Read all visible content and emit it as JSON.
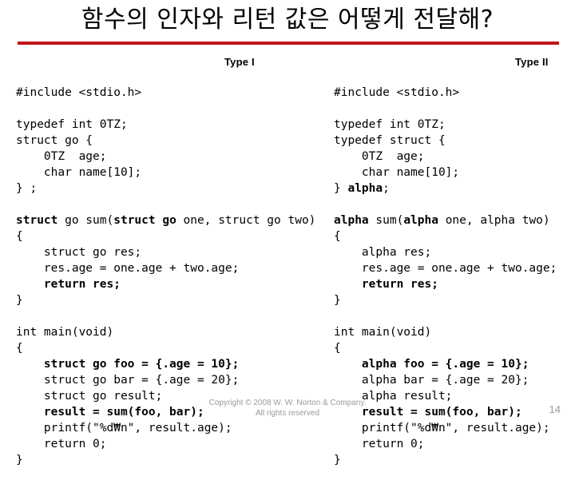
{
  "slide": {
    "title": "함수의 인자와 리턴 값은 어떻게 전달해?",
    "accent_color": "#C0151B",
    "background_color": "#FFFFFF",
    "page_number": "14"
  },
  "columns": {
    "left": {
      "type_label": "Type I",
      "lines": [
        [
          {
            "t": "#include <stdio.h>",
            "b": false
          }
        ],
        [],
        [
          {
            "t": "typedef int 0TZ;",
            "b": false
          }
        ],
        [
          {
            "t": "struct go {",
            "b": false
          }
        ],
        [
          {
            "t": "    0TZ  age;",
            "b": false
          }
        ],
        [
          {
            "t": "    char name[10];",
            "b": false
          }
        ],
        [
          {
            "t": "} ;",
            "b": false
          }
        ],
        [],
        [
          {
            "t": "struct",
            "b": true
          },
          {
            "t": " go sum(",
            "b": false
          },
          {
            "t": "struct go",
            "b": true
          },
          {
            "t": " one, struct go two)",
            "b": false
          }
        ],
        [
          {
            "t": "{",
            "b": false
          }
        ],
        [
          {
            "t": "    struct go res;",
            "b": false
          }
        ],
        [
          {
            "t": "    res.age = one.age + two.age;",
            "b": false
          }
        ],
        [
          {
            "t": "    ",
            "b": false
          },
          {
            "t": "return res;",
            "b": true
          }
        ],
        [
          {
            "t": "}",
            "b": false
          }
        ],
        [],
        [
          {
            "t": "int main(void)",
            "b": false
          }
        ],
        [
          {
            "t": "{",
            "b": false
          }
        ],
        [
          {
            "t": "    ",
            "b": false
          },
          {
            "t": "struct go foo = {.age = 10};",
            "b": true
          }
        ],
        [
          {
            "t": "    struct go bar = {.age = 20};",
            "b": false
          }
        ],
        [
          {
            "t": "    struct go result;",
            "b": false
          }
        ],
        [
          {
            "t": "    ",
            "b": false
          },
          {
            "t": "result = sum(foo, bar);",
            "b": true
          }
        ],
        [
          {
            "t": "    printf(\"%d₩n\", result.age);",
            "b": false
          }
        ],
        [
          {
            "t": "    return 0;",
            "b": false
          }
        ],
        [
          {
            "t": "}",
            "b": false
          }
        ]
      ]
    },
    "right": {
      "type_label": "Type II",
      "lines": [
        [
          {
            "t": "#include <stdio.h>",
            "b": false
          }
        ],
        [],
        [
          {
            "t": "typedef int 0TZ;",
            "b": false
          }
        ],
        [
          {
            "t": "typedef struct {",
            "b": false
          }
        ],
        [
          {
            "t": "    0TZ  age;",
            "b": false
          }
        ],
        [
          {
            "t": "    char name[10];",
            "b": false
          }
        ],
        [
          {
            "t": "} ",
            "b": false
          },
          {
            "t": "alpha",
            "b": true
          },
          {
            "t": ";",
            "b": false
          }
        ],
        [],
        [
          {
            "t": "alpha",
            "b": true
          },
          {
            "t": " sum(",
            "b": false
          },
          {
            "t": "alpha",
            "b": true
          },
          {
            "t": " one, alpha two)",
            "b": false
          }
        ],
        [
          {
            "t": "{",
            "b": false
          }
        ],
        [
          {
            "t": "    alpha res;",
            "b": false
          }
        ],
        [
          {
            "t": "    res.age = one.age + two.age;",
            "b": false
          }
        ],
        [
          {
            "t": "    ",
            "b": false
          },
          {
            "t": "return res;",
            "b": true
          }
        ],
        [
          {
            "t": "}",
            "b": false
          }
        ],
        [],
        [
          {
            "t": "int main(void)",
            "b": false
          }
        ],
        [
          {
            "t": "{",
            "b": false
          }
        ],
        [
          {
            "t": "    ",
            "b": false
          },
          {
            "t": "alpha foo = {.age = 10};",
            "b": true
          }
        ],
        [
          {
            "t": "    alpha bar = {.age = 20};",
            "b": false
          }
        ],
        [
          {
            "t": "    alpha result;",
            "b": false
          }
        ],
        [
          {
            "t": "    ",
            "b": false
          },
          {
            "t": "result = sum(foo, bar);",
            "b": true
          }
        ],
        [
          {
            "t": "    printf(\"%d₩n\", result.age);",
            "b": false
          }
        ],
        [
          {
            "t": "    return 0;",
            "b": false
          }
        ],
        [
          {
            "t": "}",
            "b": false
          }
        ]
      ]
    }
  },
  "footer": {
    "line1": "Copyright © 2008 W. W. Norton & Company.",
    "line2": "All rights reserved"
  }
}
